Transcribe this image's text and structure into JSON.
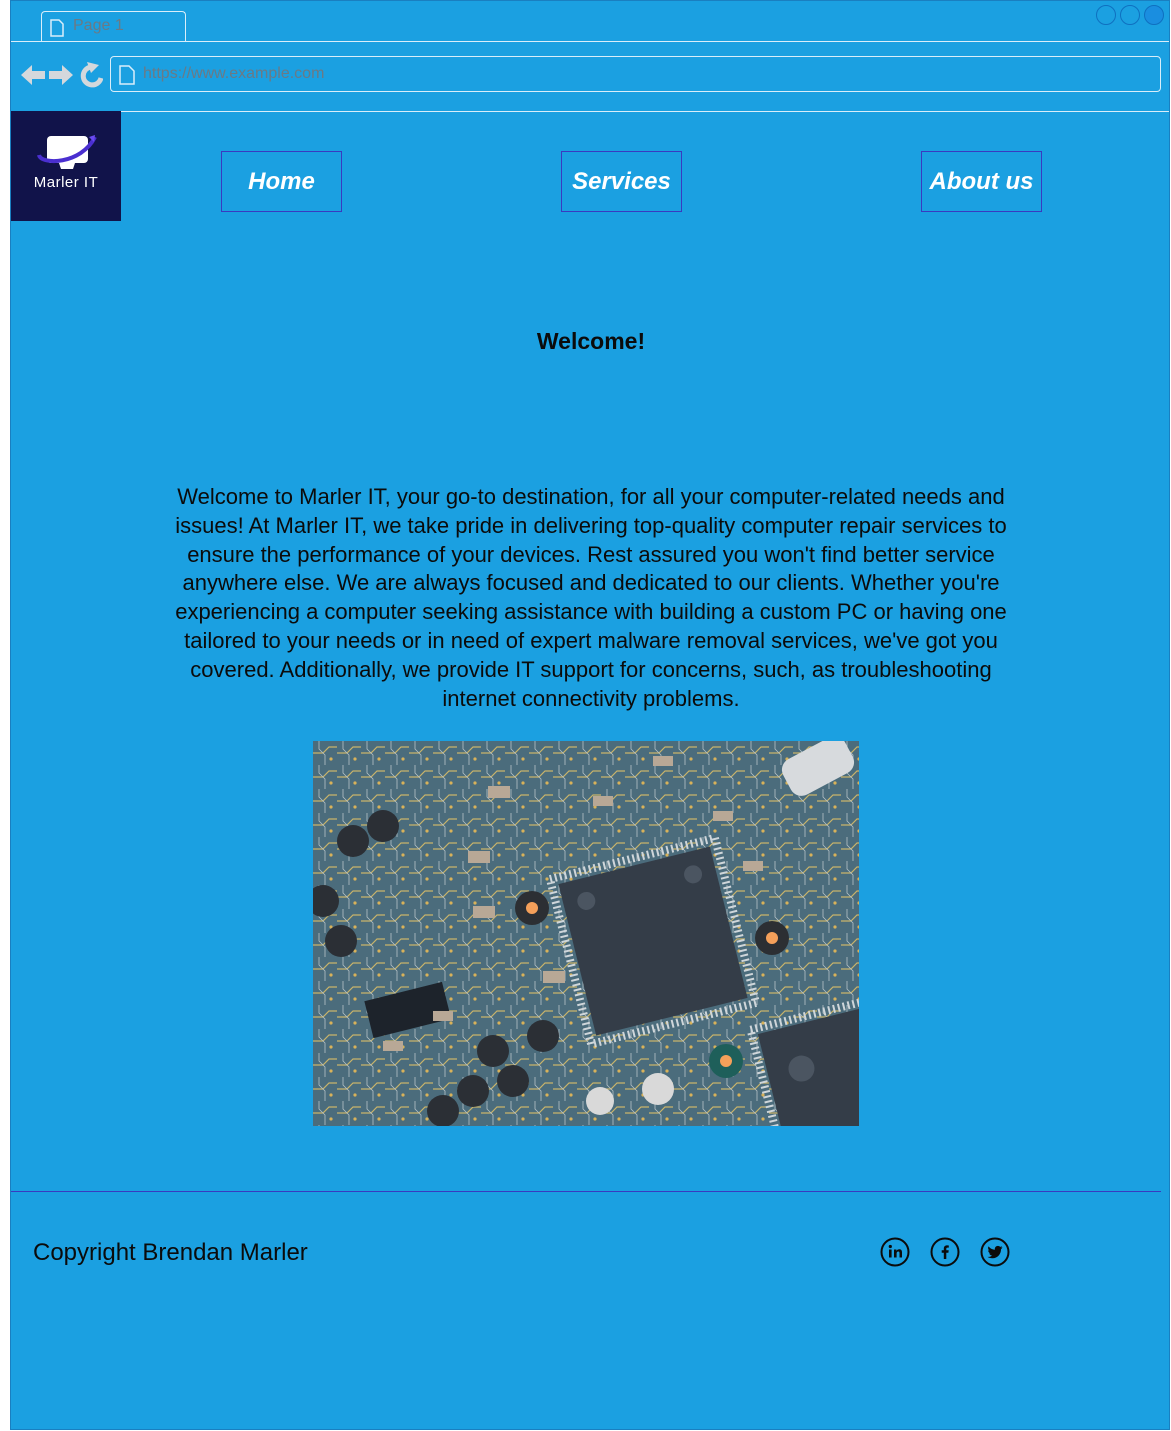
{
  "browser": {
    "tab_label": "Page 1",
    "url_placeholder": "https://www.example.com"
  },
  "site": {
    "logo_text": "Marler IT",
    "nav": [
      {
        "label": "Home"
      },
      {
        "label": "Services"
      },
      {
        "label": "About us"
      }
    ],
    "heading": "Welcome!",
    "intro": "Welcome to Marler IT, your go-to destination, for all your computer-related needs and issues! At Marler IT, we take pride in delivering top-quality computer repair services to ensure the performance of your devices. Rest assured you won't find better service anywhere else. We are always focused and dedicated to our clients. Whether you're experiencing a computer seeking assistance with building a custom PC or having one tailored to your needs or in need of expert malware removal services, we've got you covered. Additionally, we provide IT support for concerns, such, as troubleshooting internet connectivity problems.",
    "footer": {
      "copyright": "Copyright Brendan Marler",
      "social_icons": [
        "linkedin-icon",
        "facebook-icon",
        "twitter-icon"
      ]
    }
  },
  "colors": {
    "page_bg": "#1ba0e1",
    "logo_bg": "#11134a",
    "nav_border": "#3a3ac0"
  }
}
